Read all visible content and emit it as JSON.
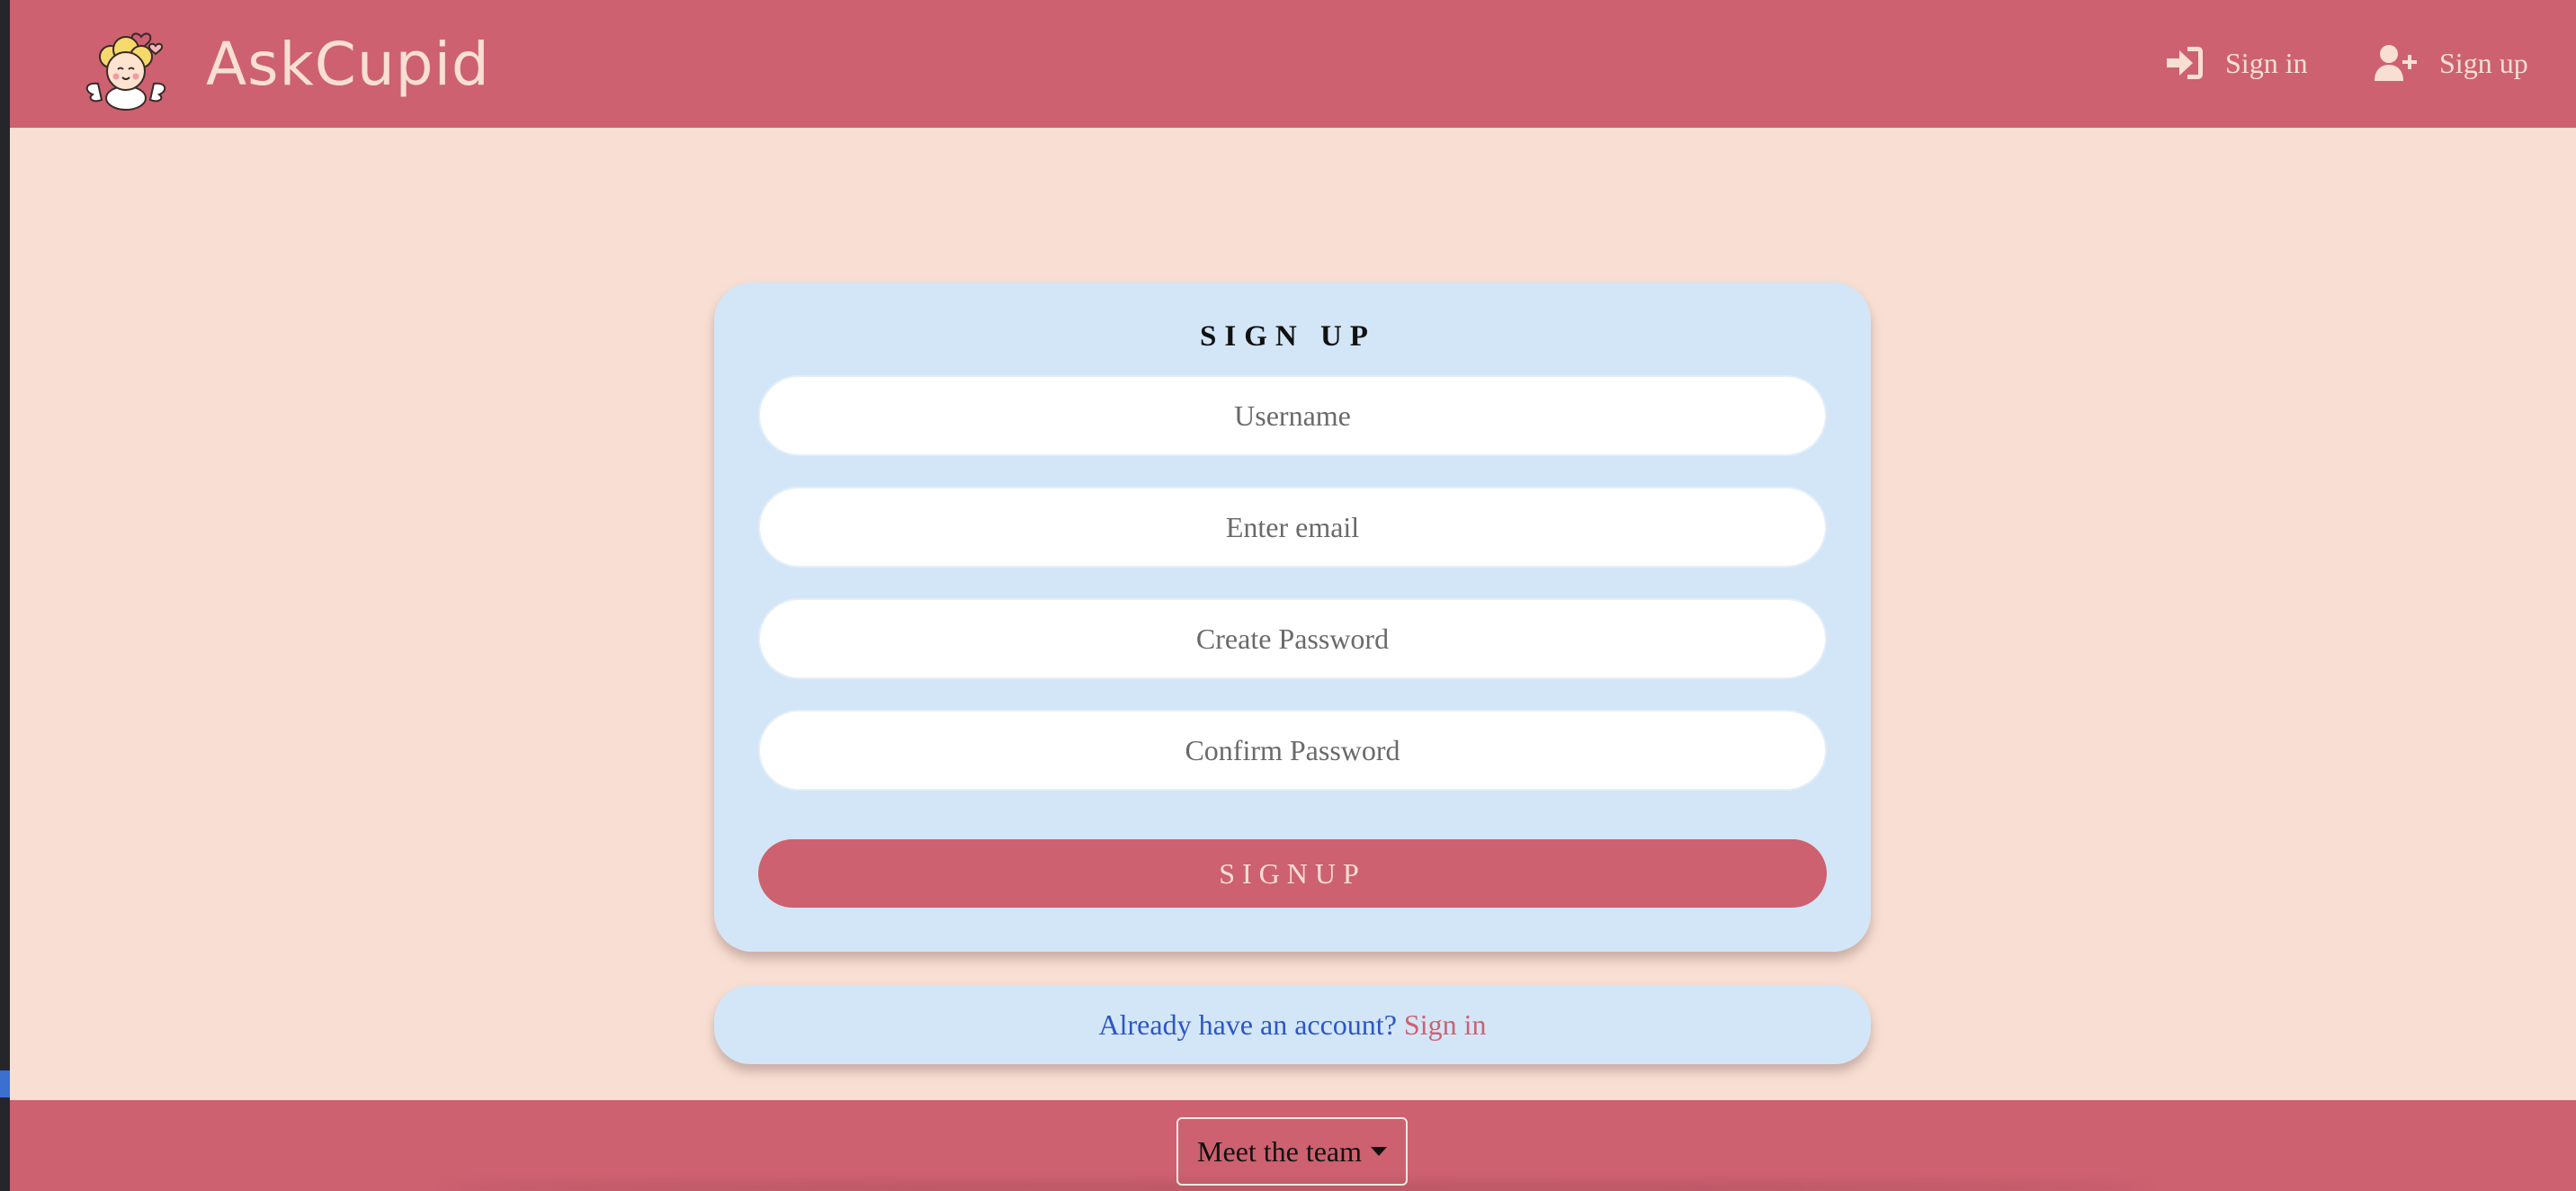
{
  "app": {
    "name": "AskCupid",
    "logo_icon": "cupid-logo-icon"
  },
  "nav": {
    "signin": {
      "label": "Sign in",
      "icon": "sign-in-icon"
    },
    "signup": {
      "label": "Sign up",
      "icon": "user-plus-icon"
    }
  },
  "form": {
    "title": "SIGN UP",
    "username_placeholder": "Username",
    "email_placeholder": "Enter email",
    "password_placeholder": "Create Password",
    "confirm_placeholder": "Confirm Password",
    "submit_label": "SIGNUP"
  },
  "signin_prompt": {
    "text": "Already have an account?",
    "link": "Sign in"
  },
  "footer": {
    "team_button": "Meet the team"
  },
  "colors": {
    "brand": "#cd6170",
    "background": "#f9dfd3",
    "card": "#d3e6f7",
    "link_blue": "#2b56c9"
  }
}
